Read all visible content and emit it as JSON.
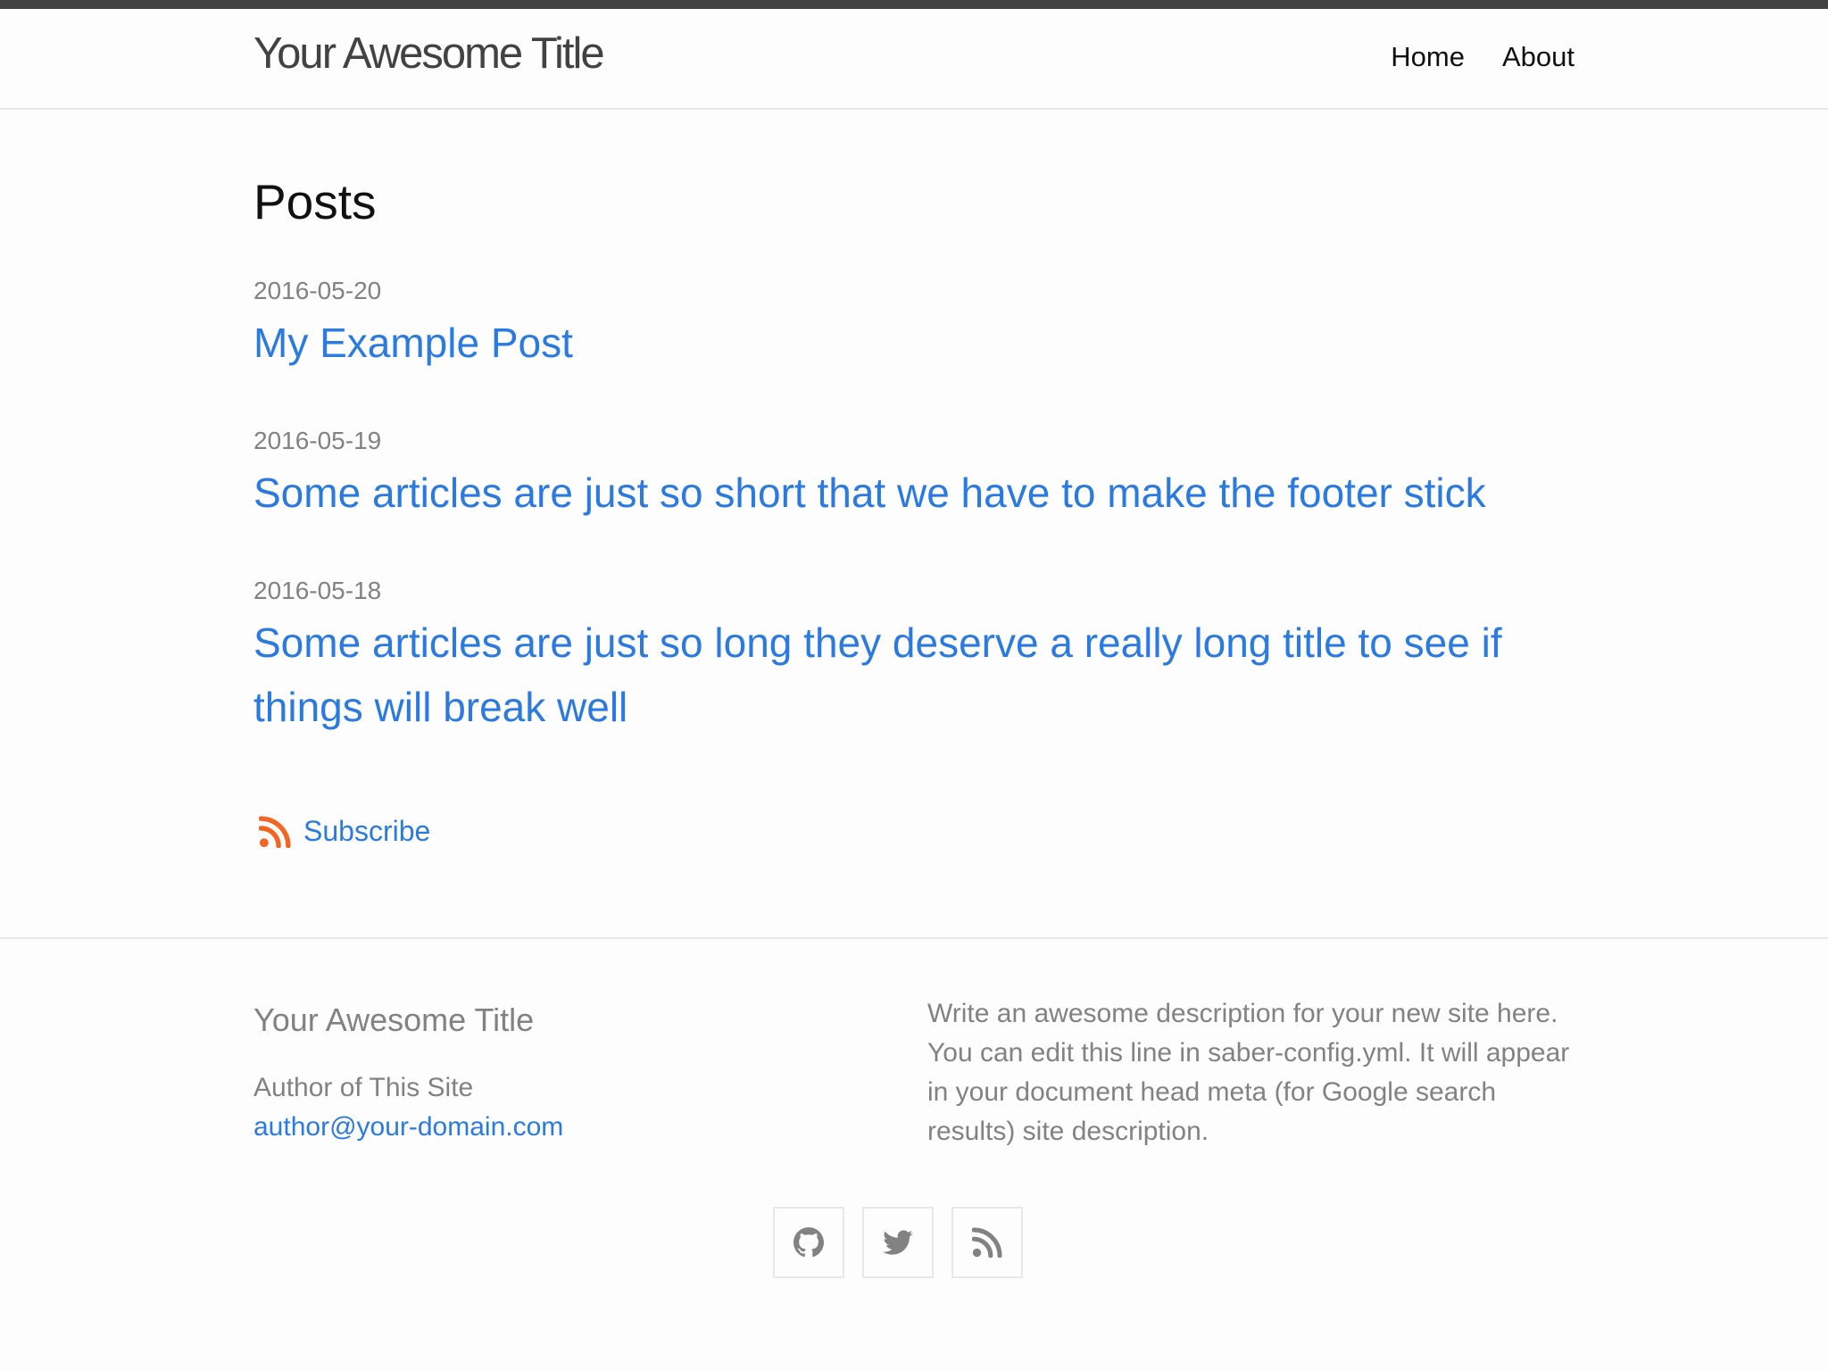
{
  "header": {
    "site_title": "Your Awesome Title",
    "nav": [
      {
        "label": "Home"
      },
      {
        "label": "About"
      }
    ]
  },
  "main": {
    "heading": "Posts",
    "posts": [
      {
        "date": "2016-05-20",
        "title": "My Example Post"
      },
      {
        "date": "2016-05-19",
        "title": "Some articles are just so short that we have to make the footer stick"
      },
      {
        "date": "2016-05-18",
        "title": "Some articles are just so long they deserve a really long title to see if things will break well"
      }
    ],
    "subscribe_label": "Subscribe",
    "subscribe_icon": "rss-icon"
  },
  "footer": {
    "title": "Your Awesome Title",
    "author": "Author of This Site",
    "email": "author@your-domain.com",
    "description": "Write an awesome description for your new site here. You can edit this line in saber-config.yml. It will appear in your document head meta (for Google search results) site description.",
    "social": [
      {
        "icon": "github-icon"
      },
      {
        "icon": "twitter-icon"
      },
      {
        "icon": "rss-icon"
      }
    ]
  },
  "colors": {
    "link": "#2a7ae2",
    "muted": "#828282",
    "rss": "#f26522",
    "top_bar": "#424242",
    "border": "#e8e8e8"
  }
}
